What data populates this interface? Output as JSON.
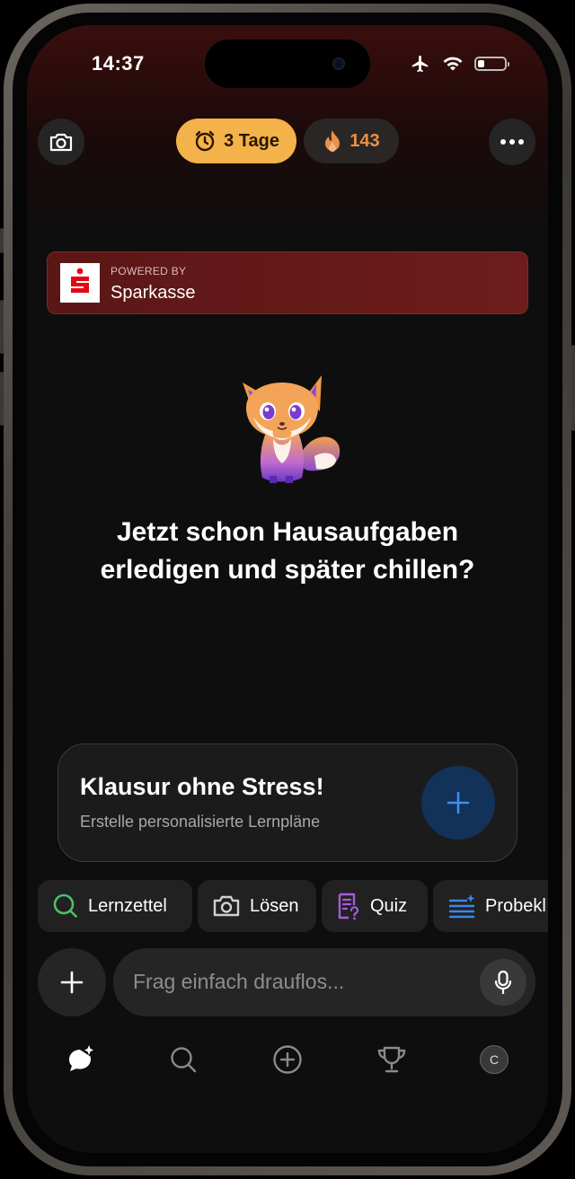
{
  "status_bar": {
    "time": "14:37",
    "icons": [
      "airplane-icon",
      "wifi-icon",
      "battery-icon"
    ],
    "battery_level": 0.25
  },
  "header": {
    "streak_label": "3 Tage",
    "score_label": "143",
    "icons": {
      "left": "camera-icon",
      "right": "more-icon"
    }
  },
  "banner": {
    "powered_by": "POWERED BY",
    "sponsor": "Sparkasse",
    "colors": {
      "background": "#6a1a1a",
      "logo": "#e30613"
    }
  },
  "main": {
    "headline_line1": "Jetzt schon Hausaufgaben",
    "headline_line2": "erledigen und später chillen?"
  },
  "card": {
    "title": "Klausur ohne Stress!",
    "subtitle": "Erstelle personalisierte Lernpläne",
    "accent": "#1e78e8"
  },
  "chips": [
    {
      "label": "Lernzettel",
      "icon": "search-icon",
      "color": "#4cbf6a"
    },
    {
      "label": "Lösen",
      "icon": "camera-icon",
      "color": "#d0d0d0"
    },
    {
      "label": "Quiz",
      "icon": "quiz-icon",
      "color": "#a45ce0"
    },
    {
      "label": "Probekl",
      "icon": "text-sparkle-icon",
      "color": "#3d86e8"
    }
  ],
  "input": {
    "placeholder": "Frag einfach drauflos..."
  },
  "tab_bar": {
    "items": [
      "chat-sparkle-icon",
      "search-icon",
      "add-icon",
      "trophy-icon",
      "avatar"
    ],
    "avatar_initial": "C"
  }
}
